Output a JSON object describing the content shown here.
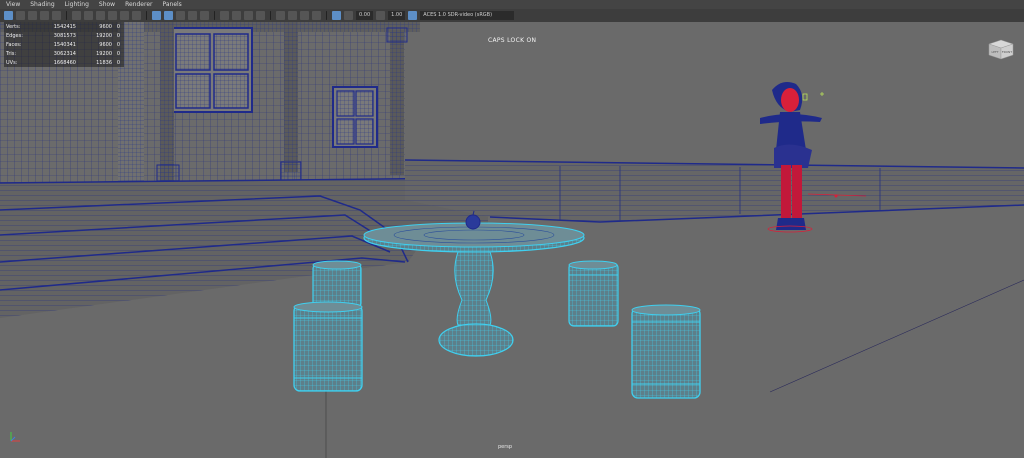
{
  "menu": [
    "View",
    "Shading",
    "Lighting",
    "Show",
    "Renderer",
    "Panels"
  ],
  "toolbar": {
    "exposure": "0.00",
    "gamma": "1.00",
    "color_space": "ACES 1.0 SDR-video (sRGB)"
  },
  "hud": {
    "rows": [
      {
        "label": "Verts:",
        "a": "1542415",
        "b": "9600",
        "c": "0"
      },
      {
        "label": "Edges:",
        "a": "3081573",
        "b": "19200",
        "c": "0"
      },
      {
        "label": "Faces:",
        "a": "1540341",
        "b": "9600",
        "c": "0"
      },
      {
        "label": "Tris:",
        "a": "3062314",
        "b": "19200",
        "c": "0"
      },
      {
        "label": "UVs:",
        "a": "1668460",
        "b": "11836",
        "c": "0"
      }
    ]
  },
  "status": {
    "caps_lock": "CAPS LOCK ON"
  },
  "camera": {
    "name": "persp"
  },
  "viewcube": {
    "face_left": "LEFT",
    "face_front": "FRONT"
  },
  "colors": {
    "viewport_bg": "#6a6a6a",
    "wireframe_dark": "#1f2a8a",
    "wireframe_selected": "#3fd0f0",
    "character_red": "#d8203a"
  }
}
